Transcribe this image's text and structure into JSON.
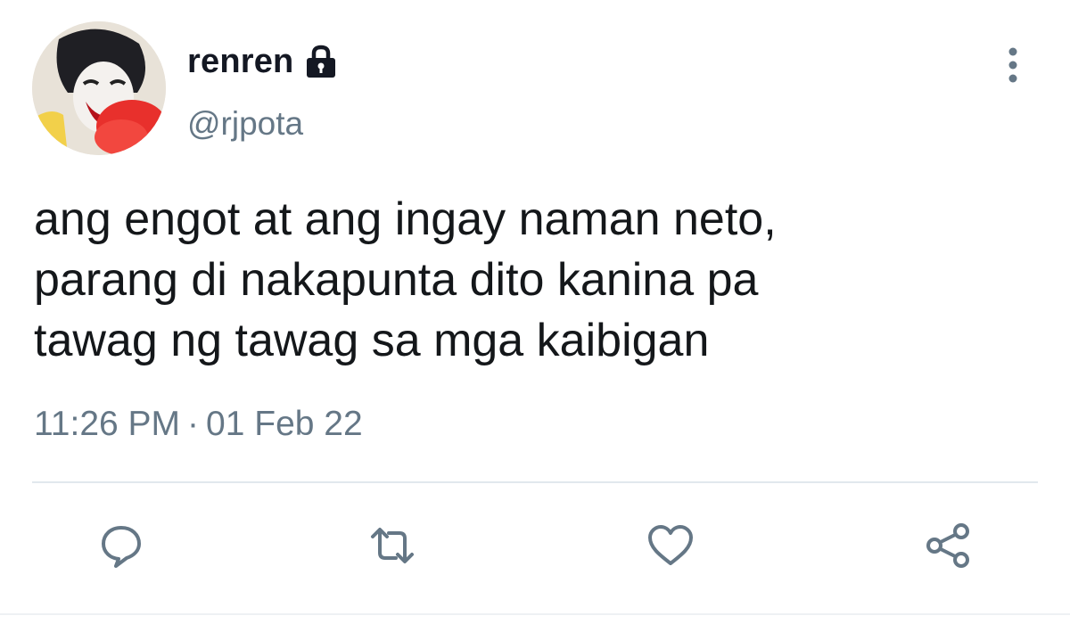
{
  "user": {
    "display_name": "renren",
    "handle": "@rjpota",
    "protected_icon": "lock-icon",
    "avatar": "profile-photo"
  },
  "tweet": {
    "lines": [
      "ang engot at ang ingay naman neto,",
      "parang di nakapunta dito kanina pa",
      "tawag ng tawag sa mga kaibigan"
    ],
    "time": "11:26 PM",
    "separator": "·",
    "date": "01 Feb 22"
  },
  "actions": [
    {
      "name": "reply",
      "icon": "comment-icon"
    },
    {
      "name": "retweet",
      "icon": "retweet-icon"
    },
    {
      "name": "like",
      "icon": "heart-icon"
    },
    {
      "name": "share",
      "icon": "share-icon"
    }
  ],
  "menu_icon": "more-vertical-icon",
  "colors": {
    "text": "#14171a",
    "secondary": "#657786",
    "divider": "#e1e8ed"
  }
}
